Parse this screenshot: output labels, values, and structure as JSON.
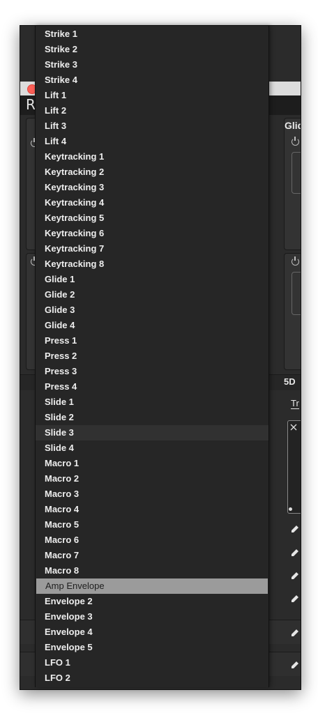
{
  "app": {
    "logo_glyph": "R",
    "panel_headers": {
      "glide": "Glid",
      "fived": "5D"
    },
    "tab_partial": "Tr"
  },
  "menu": {
    "items": [
      {
        "label": "Strike 1",
        "state": "normal"
      },
      {
        "label": "Strike 2",
        "state": "normal"
      },
      {
        "label": "Strike 3",
        "state": "normal"
      },
      {
        "label": "Strike 4",
        "state": "normal"
      },
      {
        "label": "Lift 1",
        "state": "normal"
      },
      {
        "label": "Lift 2",
        "state": "normal"
      },
      {
        "label": "Lift 3",
        "state": "normal"
      },
      {
        "label": "Lift 4",
        "state": "normal"
      },
      {
        "label": "Keytracking 1",
        "state": "normal"
      },
      {
        "label": "Keytracking 2",
        "state": "normal"
      },
      {
        "label": "Keytracking 3",
        "state": "normal"
      },
      {
        "label": "Keytracking 4",
        "state": "normal"
      },
      {
        "label": "Keytracking 5",
        "state": "normal"
      },
      {
        "label": "Keytracking 6",
        "state": "normal"
      },
      {
        "label": "Keytracking 7",
        "state": "normal"
      },
      {
        "label": "Keytracking 8",
        "state": "normal"
      },
      {
        "label": "Glide 1",
        "state": "normal"
      },
      {
        "label": "Glide 2",
        "state": "normal"
      },
      {
        "label": "Glide 3",
        "state": "normal"
      },
      {
        "label": "Glide 4",
        "state": "normal"
      },
      {
        "label": "Press 1",
        "state": "normal"
      },
      {
        "label": "Press 2",
        "state": "normal"
      },
      {
        "label": "Press 3",
        "state": "normal"
      },
      {
        "label": "Press 4",
        "state": "normal"
      },
      {
        "label": "Slide 1",
        "state": "normal"
      },
      {
        "label": "Slide 2",
        "state": "normal"
      },
      {
        "label": "Slide 3",
        "state": "hovered"
      },
      {
        "label": "Slide 4",
        "state": "normal"
      },
      {
        "label": "Macro 1",
        "state": "normal"
      },
      {
        "label": "Macro 2",
        "state": "normal"
      },
      {
        "label": "Macro 3",
        "state": "normal"
      },
      {
        "label": "Macro 4",
        "state": "normal"
      },
      {
        "label": "Macro 5",
        "state": "normal"
      },
      {
        "label": "Macro 6",
        "state": "normal"
      },
      {
        "label": "Macro 7",
        "state": "normal"
      },
      {
        "label": "Macro 8",
        "state": "normal"
      },
      {
        "label": "Amp Envelope",
        "state": "selected"
      },
      {
        "label": "Envelope 2",
        "state": "normal"
      },
      {
        "label": "Envelope 3",
        "state": "normal"
      },
      {
        "label": "Envelope 4",
        "state": "normal"
      },
      {
        "label": "Envelope 5",
        "state": "normal"
      },
      {
        "label": "LFO 1",
        "state": "normal"
      },
      {
        "label": "LFO 2",
        "state": "normal"
      }
    ]
  },
  "colors": {
    "menu_bg": "#262626",
    "menu_selected_bg": "#9b9b9b",
    "menu_hover_bg": "#313131",
    "accent_blue": "#3a7fd0"
  }
}
